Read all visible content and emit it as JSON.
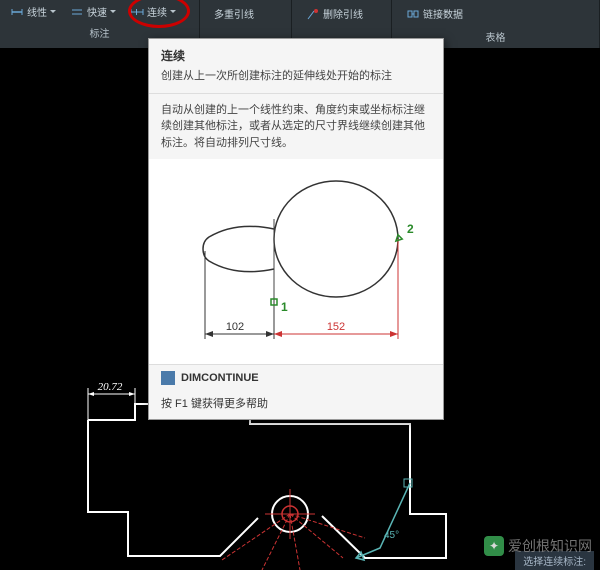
{
  "toolbar": {
    "sections": [
      {
        "label": "标注",
        "buttons": [
          {
            "label": "线性",
            "icon": "linear"
          },
          {
            "label": "快速",
            "icon": "quick"
          },
          {
            "label": "连续",
            "icon": "continue"
          }
        ]
      },
      {
        "label": "",
        "buttons": [
          {
            "label": "多重引线",
            "icon": "mleader"
          }
        ]
      },
      {
        "label": "",
        "buttons": [
          {
            "label": "删除引线",
            "icon": "delete"
          }
        ]
      },
      {
        "label": "表格",
        "buttons": [
          {
            "label": "链接数据",
            "icon": "link"
          }
        ]
      }
    ]
  },
  "tooltip": {
    "title": "连续",
    "description": "创建从上一次所创建标注的延伸线处开始的标注",
    "body": "自动从创建的上一个线性约束、角度约束或坐标标注继续创建其他标注，或者从选定的尺寸界线继续创建其他标注。将自动排列尺寸线。",
    "diagram": {
      "dim1": "102",
      "dim2": "152",
      "marker1": "1",
      "marker2": "2"
    },
    "command": "DIMCONTINUE",
    "help": "按 F1 键获得更多帮助"
  },
  "drawing": {
    "dimension": "20.72",
    "angle": "45°"
  },
  "status": "选择连续标注:",
  "watermark": "爱创根知识网"
}
